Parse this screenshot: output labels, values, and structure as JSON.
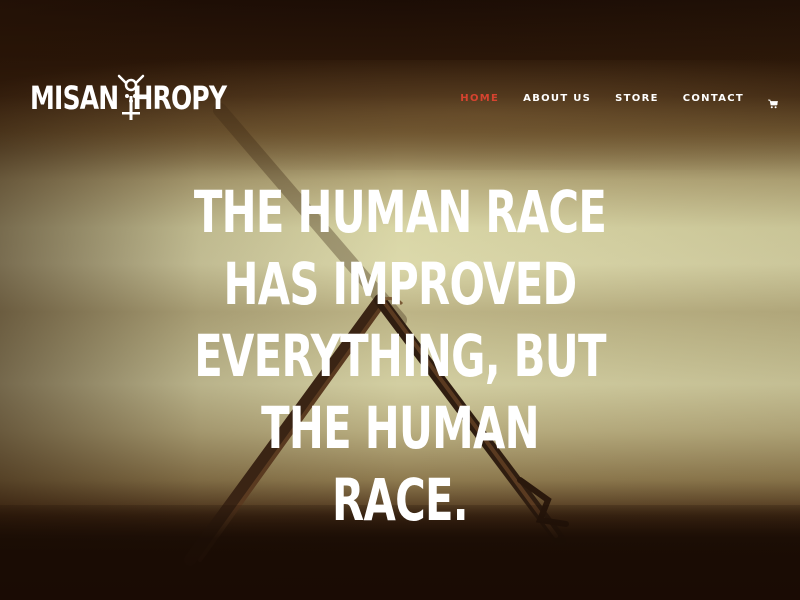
{
  "brand": {
    "logo_text": "MISANTHROPY",
    "logo_prefix": "MISAN",
    "logo_suffix": "HROPY"
  },
  "nav": {
    "items": [
      {
        "label": "HOME",
        "active": true
      },
      {
        "label": "ABOUT US",
        "active": false
      },
      {
        "label": "STORE",
        "active": false
      },
      {
        "label": "CONTACT",
        "active": false
      }
    ],
    "cart_icon": "shopping-cart-icon"
  },
  "hero": {
    "headline_lines": [
      "THE HUMAN RACE",
      "HAS IMPROVED",
      "EVERYTHING, BUT",
      "THE HUMAN",
      "RACE."
    ]
  },
  "colors": {
    "accent": "#d6432f",
    "text": "#ffffff",
    "background_dark": "#1a0b04"
  }
}
